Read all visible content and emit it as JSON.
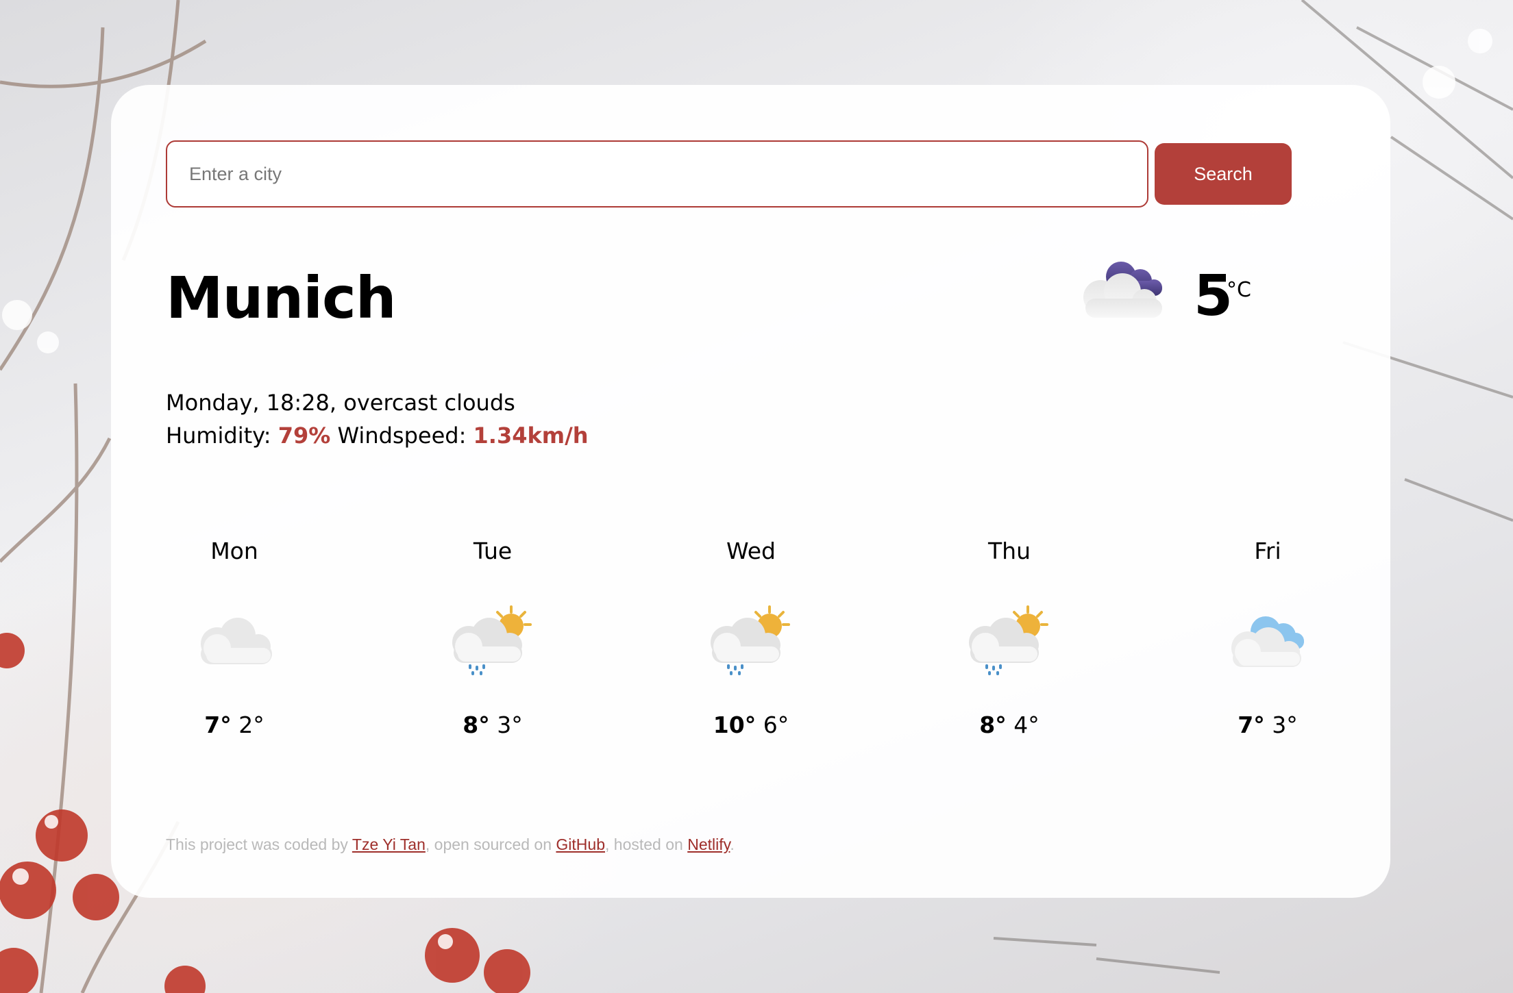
{
  "search": {
    "placeholder": "Enter a city",
    "button_label": "Search"
  },
  "current": {
    "city": "Munich",
    "temperature": "5",
    "unit": "°C",
    "icon": "overcast-clouds-icon",
    "description_line": "Monday, 18:28, overcast clouds",
    "humidity_label": "Humidity:",
    "humidity_value": "79%",
    "windspeed_label": "Windspeed:",
    "windspeed_value": "1.34km/h"
  },
  "forecast": [
    {
      "day": "Mon",
      "max": "7°",
      "min": "2°",
      "icon": "cloud-icon"
    },
    {
      "day": "Tue",
      "max": "8°",
      "min": "3°",
      "icon": "sun-cloud-rain-icon"
    },
    {
      "day": "Wed",
      "max": "10°",
      "min": "6°",
      "icon": "sun-cloud-rain-icon"
    },
    {
      "day": "Thu",
      "max": "8°",
      "min": "4°",
      "icon": "sun-cloud-rain-icon"
    },
    {
      "day": "Fri",
      "max": "7°",
      "min": "3°",
      "icon": "cloud-icon"
    }
  ],
  "footer": {
    "text_1": "This project was coded by ",
    "author_link": "Tze Yi Tan",
    "text_2": ", open sourced on ",
    "github_link": "GitHub",
    "text_3": ", hosted on ",
    "netlify_link": "Netlify",
    "text_4": "."
  },
  "colors": {
    "accent": "#b3403a",
    "link": "#9e2e2a",
    "footer_text": "#b9b9b9"
  }
}
